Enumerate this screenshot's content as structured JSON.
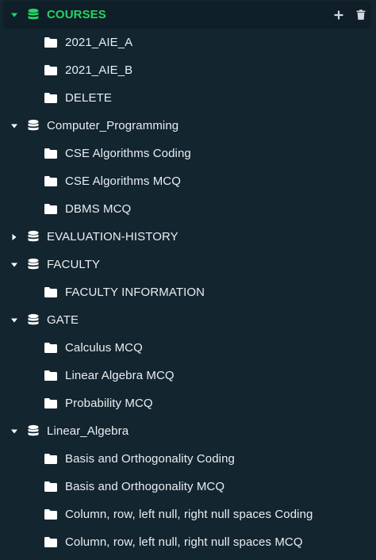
{
  "colors": {
    "background": "#13252f",
    "selected_background": "#0f1e27",
    "accent": "#25d366",
    "text": "#e9eef1",
    "icon": "#ffffff"
  },
  "tree": {
    "databases": [
      {
        "label": "COURSES",
        "expanded": true,
        "selected": true,
        "icon": "database-icon",
        "actions": [
          "add-icon",
          "trash-icon"
        ],
        "children": [
          "2021_AIE_A",
          "2021_AIE_B",
          "DELETE"
        ]
      },
      {
        "label": "Computer_Programming",
        "expanded": true,
        "icon": "database-icon",
        "children": [
          "CSE Algorithms Coding",
          "CSE Algorithms MCQ",
          "DBMS MCQ"
        ]
      },
      {
        "label": "EVALUATION-HISTORY",
        "expanded": false,
        "icon": "database-icon",
        "children": []
      },
      {
        "label": "FACULTY",
        "expanded": true,
        "icon": "database-icon",
        "children": [
          "FACULTY INFORMATION"
        ]
      },
      {
        "label": "GATE",
        "expanded": true,
        "icon": "database-icon",
        "children": [
          "Calculus MCQ",
          "Linear Algebra MCQ",
          "Probability MCQ"
        ]
      },
      {
        "label": "Linear_Algebra",
        "expanded": true,
        "icon": "database-icon",
        "children": [
          "Basis and Orthogonality Coding",
          "Basis and Orthogonality MCQ",
          "Column, row, left null, right null spaces Coding",
          "Column, row, left null, right null spaces MCQ"
        ]
      }
    ]
  }
}
